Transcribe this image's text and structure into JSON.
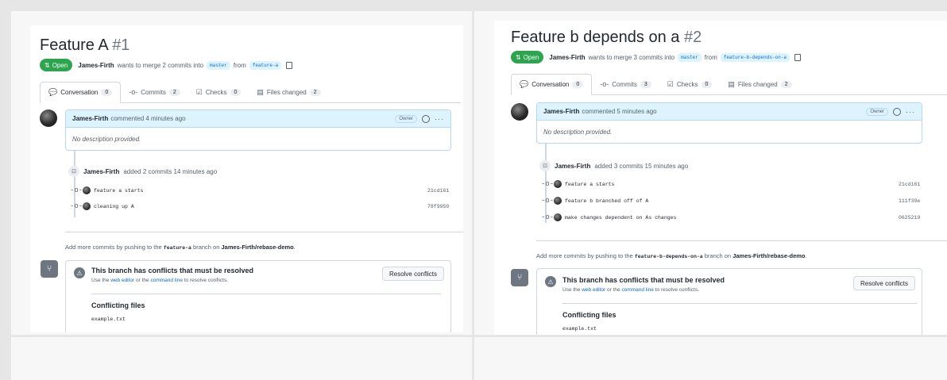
{
  "panels": [
    {
      "title": "Feature A",
      "number": "#1",
      "status": "Open",
      "author": "James-Firth",
      "merge_text": "wants to merge 2 commits into",
      "base_branch": "master",
      "from_text": "from",
      "head_branch": "feature-a",
      "tabs": [
        {
          "label": "Conversation",
          "count": "0"
        },
        {
          "label": "Commits",
          "count": "2"
        },
        {
          "label": "Checks",
          "count": "0"
        },
        {
          "label": "Files changed",
          "count": "2"
        }
      ],
      "comment": {
        "author": "James-Firth",
        "time": "commented 4 minutes ago",
        "role": "Owner",
        "body": "No description provided."
      },
      "event": {
        "author": "James-Firth",
        "text": "added 2 commits 14 minutes ago"
      },
      "commits": [
        {
          "message": "feature a starts",
          "sha": "21cd161"
        },
        {
          "message": "cleaning up A",
          "sha": "78f9950"
        }
      ],
      "hint": {
        "prefix": "Add more commits by pushing to the",
        "branch": "feature-a",
        "middle": "branch on",
        "repo": "James-Firth/rebase-demo",
        "suffix": "."
      },
      "conflict": {
        "title": "This branch has conflicts that must be resolved",
        "sub_prefix": "Use the",
        "link1": "web editor",
        "sub_middle": "or the",
        "link2": "command line",
        "sub_suffix": "to resolve conflicts.",
        "button": "Resolve conflicts",
        "files_title": "Conflicting files",
        "files": [
          "example.txt"
        ]
      }
    },
    {
      "title": "Feature b depends on a",
      "number": "#2",
      "status": "Open",
      "author": "James-Firth",
      "merge_text": "wants to merge 3 commits into",
      "base_branch": "master",
      "from_text": "from",
      "head_branch": "feature-b-depends-on-a",
      "tabs": [
        {
          "label": "Conversation",
          "count": "0"
        },
        {
          "label": "Commits",
          "count": "3"
        },
        {
          "label": "Checks",
          "count": "0"
        },
        {
          "label": "Files changed",
          "count": "2"
        }
      ],
      "comment": {
        "author": "James-Firth",
        "time": "commented 5 minutes ago",
        "role": "Owner",
        "body": "No description provided."
      },
      "event": {
        "author": "James-Firth",
        "text": "added 3 commits 15 minutes ago"
      },
      "commits": [
        {
          "message": "feature a starts",
          "sha": "21cd161"
        },
        {
          "message": "feature b branched off of A",
          "sha": "111f39e"
        },
        {
          "message": "make changes dependent on As changes",
          "sha": "0625219"
        }
      ],
      "hint": {
        "prefix": "Add more commits by pushing to the",
        "branch": "feature-b-depends-on-a",
        "middle": "branch on",
        "repo": "James-Firth/rebase-demo",
        "suffix": "."
      },
      "conflict": {
        "title": "This branch has conflicts that must be resolved",
        "sub_prefix": "Use the",
        "link1": "web editor",
        "sub_middle": "or the",
        "link2": "command line",
        "sub_suffix": "to resolve conflicts.",
        "button": "Resolve conflicts",
        "files_title": "Conflicting files",
        "files": [
          "example.txt"
        ]
      }
    }
  ]
}
